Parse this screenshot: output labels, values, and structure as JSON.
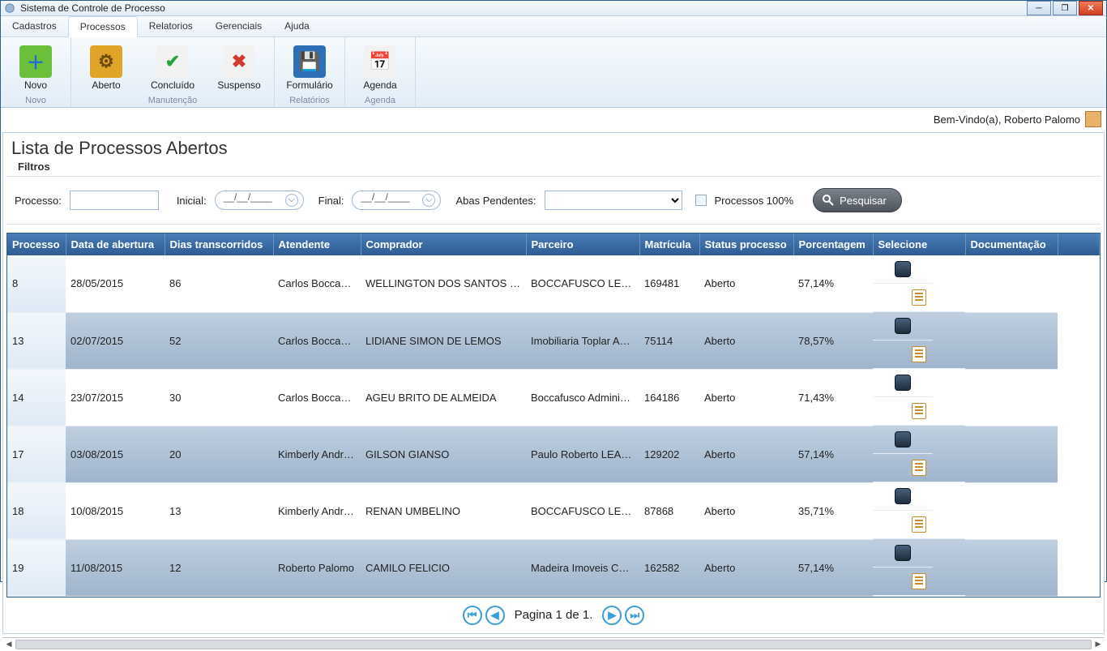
{
  "window": {
    "title": "Sistema de Controle de Processo"
  },
  "menubar": {
    "items": [
      "Cadastros",
      "Processos",
      "Relatorios",
      "Gerenciais",
      "Ajuda"
    ],
    "activeIndex": 1
  },
  "ribbon": {
    "groups": [
      {
        "label": "Novo",
        "buttons": [
          {
            "label": "Novo",
            "icon": "plus",
            "iconBg": "#6bbf3a",
            "iconFg": "#1e6bd6"
          }
        ]
      },
      {
        "label": "Manutenção",
        "buttons": [
          {
            "label": "Aberto",
            "icon": "gear",
            "iconBg": "#e0a528",
            "iconFg": "#6b4a10"
          },
          {
            "label": "Concluído",
            "icon": "check",
            "iconBg": "#f2f2f2",
            "iconFg": "#2aa33a"
          },
          {
            "label": "Suspenso",
            "icon": "cross",
            "iconBg": "#f2f2f2",
            "iconFg": "#d33a2e"
          }
        ]
      },
      {
        "label": "Relatórios",
        "buttons": [
          {
            "label": "Formulário",
            "icon": "save",
            "iconBg": "#2e6fb7",
            "iconFg": "#fff"
          }
        ]
      },
      {
        "label": "Agenda",
        "buttons": [
          {
            "label": "Agenda",
            "icon": "calendar",
            "iconBg": "#f2f2f2",
            "iconFg": "#c05a2e"
          }
        ]
      }
    ]
  },
  "welcome": {
    "text": "Bem-Vindo(a), Roberto Palomo"
  },
  "page": {
    "title": "Lista de Processos Abertos",
    "filtros_label": "Filtros",
    "labels": {
      "processo": "Processo:",
      "inicial": "Inicial:",
      "final": "Final:",
      "abas": "Abas Pendentes:",
      "pct": "Processos 100%",
      "search": "Pesquisar"
    },
    "inputs": {
      "processo": "",
      "inicial": "__/__/____",
      "final": "__/__/____",
      "abas": ""
    }
  },
  "table": {
    "columns": [
      "Processo",
      "Data de abertura",
      "Dias transcorridos",
      "Atendente",
      "Comprador",
      "Parceiro",
      "Matrícula",
      "Status processo",
      "Porcentagem",
      "Selecione",
      "Documentação"
    ],
    "rows": [
      {
        "processo": "8",
        "data": "28/05/2015",
        "dias": "86",
        "atendente": "Carlos BoccaFusco",
        "comprador": "WELLINGTON DOS SANTOS CORREA",
        "parceiro": "BOCCAFUSCO LEOPOLDI",
        "matricula": "169481",
        "status": "Aberto",
        "pct": "57,14%"
      },
      {
        "processo": "13",
        "data": "02/07/2015",
        "dias": "52",
        "atendente": "Carlos BoccaFusco",
        "comprador": "LIDIANE SIMON DE LEMOS",
        "parceiro": "Imobiliaria Toplar Admini",
        "matricula": "75114",
        "status": "Aberto",
        "pct": "78,57%"
      },
      {
        "processo": "14",
        "data": "23/07/2015",
        "dias": "30",
        "atendente": "Carlos BoccaFusco",
        "comprador": "AGEU BRITO DE ALMEIDA",
        "parceiro": "Boccafusco Administração",
        "matricula": "164186",
        "status": "Aberto",
        "pct": "71,43%"
      },
      {
        "processo": "17",
        "data": "03/08/2015",
        "dias": "20",
        "atendente": "Kimberly Andressa",
        "comprador": "GILSON GIANSO",
        "parceiro": "Paulo Roberto LEARDI",
        "matricula": "129202",
        "status": "Aberto",
        "pct": "57,14%"
      },
      {
        "processo": "18",
        "data": "10/08/2015",
        "dias": "13",
        "atendente": "Kimberly Andressa",
        "comprador": "RENAN UMBELINO",
        "parceiro": "BOCCAFUSCO LEOPOLDI",
        "matricula": "87868",
        "status": "Aberto",
        "pct": "35,71%"
      },
      {
        "processo": "19",
        "data": "11/08/2015",
        "dias": "12",
        "atendente": "Roberto Palomo",
        "comprador": "CAMILO FELICIO",
        "parceiro": "Madeira Imoveis Compra",
        "matricula": "162582",
        "status": "Aberto",
        "pct": "57,14%"
      }
    ]
  },
  "pager": {
    "text": "Pagina 1 de 1."
  }
}
